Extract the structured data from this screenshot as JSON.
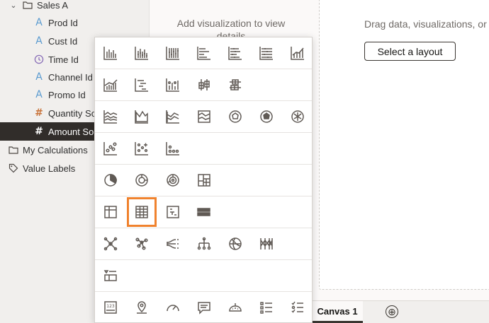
{
  "data_panel": {
    "items": [
      {
        "label": "Sales A",
        "icon": "folder-icon"
      },
      {
        "label": "Prod Id",
        "icon": "attribute-icon"
      },
      {
        "label": "Cust Id",
        "icon": "attribute-icon"
      },
      {
        "label": "Time Id",
        "icon": "time-icon"
      },
      {
        "label": "Channel Id",
        "icon": "attribute-icon"
      },
      {
        "label": "Promo Id",
        "icon": "attribute-icon"
      },
      {
        "label": "Quantity So",
        "icon": "measure-icon"
      },
      {
        "label": "Amount So",
        "icon": "measure-icon"
      },
      {
        "label": "My Calculations",
        "icon": "folder-icon"
      },
      {
        "label": "Value Labels",
        "icon": "tag-icon"
      }
    ]
  },
  "middle": {
    "hint": "Add visualization to view details"
  },
  "canvas": {
    "drag_hint": "Drag data, visualizations, or",
    "layout_button": "Select a layout",
    "tab_label": "Canvas 1",
    "add_tab_glyph": "⊕"
  },
  "picker": {
    "selected": "table",
    "rows": [
      [
        "bar-icon",
        "stacked-bar-icon",
        "100-stacked-bar-icon",
        "horizontal-bar-icon",
        "horizontal-stacked-bar-icon",
        "horizontal-100-bar-icon",
        "combo-icon"
      ],
      [
        "bar-line-icon",
        "waterfall-icon",
        "scatter-bar-icon",
        "boxplot-icon",
        "horizontal-boxplot-icon"
      ],
      [
        "line-icon",
        "area-icon",
        "stacked-area-icon",
        "100-area-icon",
        "radar-line-icon",
        "radar-area-icon",
        "radar-bar-icon"
      ],
      [
        "scatter-icon",
        "grid-scatter-icon",
        "dot-plot-icon"
      ],
      [
        "pie-icon",
        "donut-icon",
        "sunburst-icon",
        "treemap-icon"
      ],
      [
        "pivot-icon",
        "table-icon",
        "tile-table-icon",
        "heatmap-icon"
      ],
      [
        "network-icon",
        "chord-icon",
        "sankey-icon",
        "tree-diagram-icon",
        "parallel-coordinates-icon",
        "correlation-matrix-icon"
      ],
      [
        "list-icon"
      ],
      [
        "tile-icon",
        "map-icon",
        "gauge-icon",
        "text-box-icon",
        "cloud-icon",
        "list-view-icon",
        "checklist-icon"
      ]
    ]
  }
}
